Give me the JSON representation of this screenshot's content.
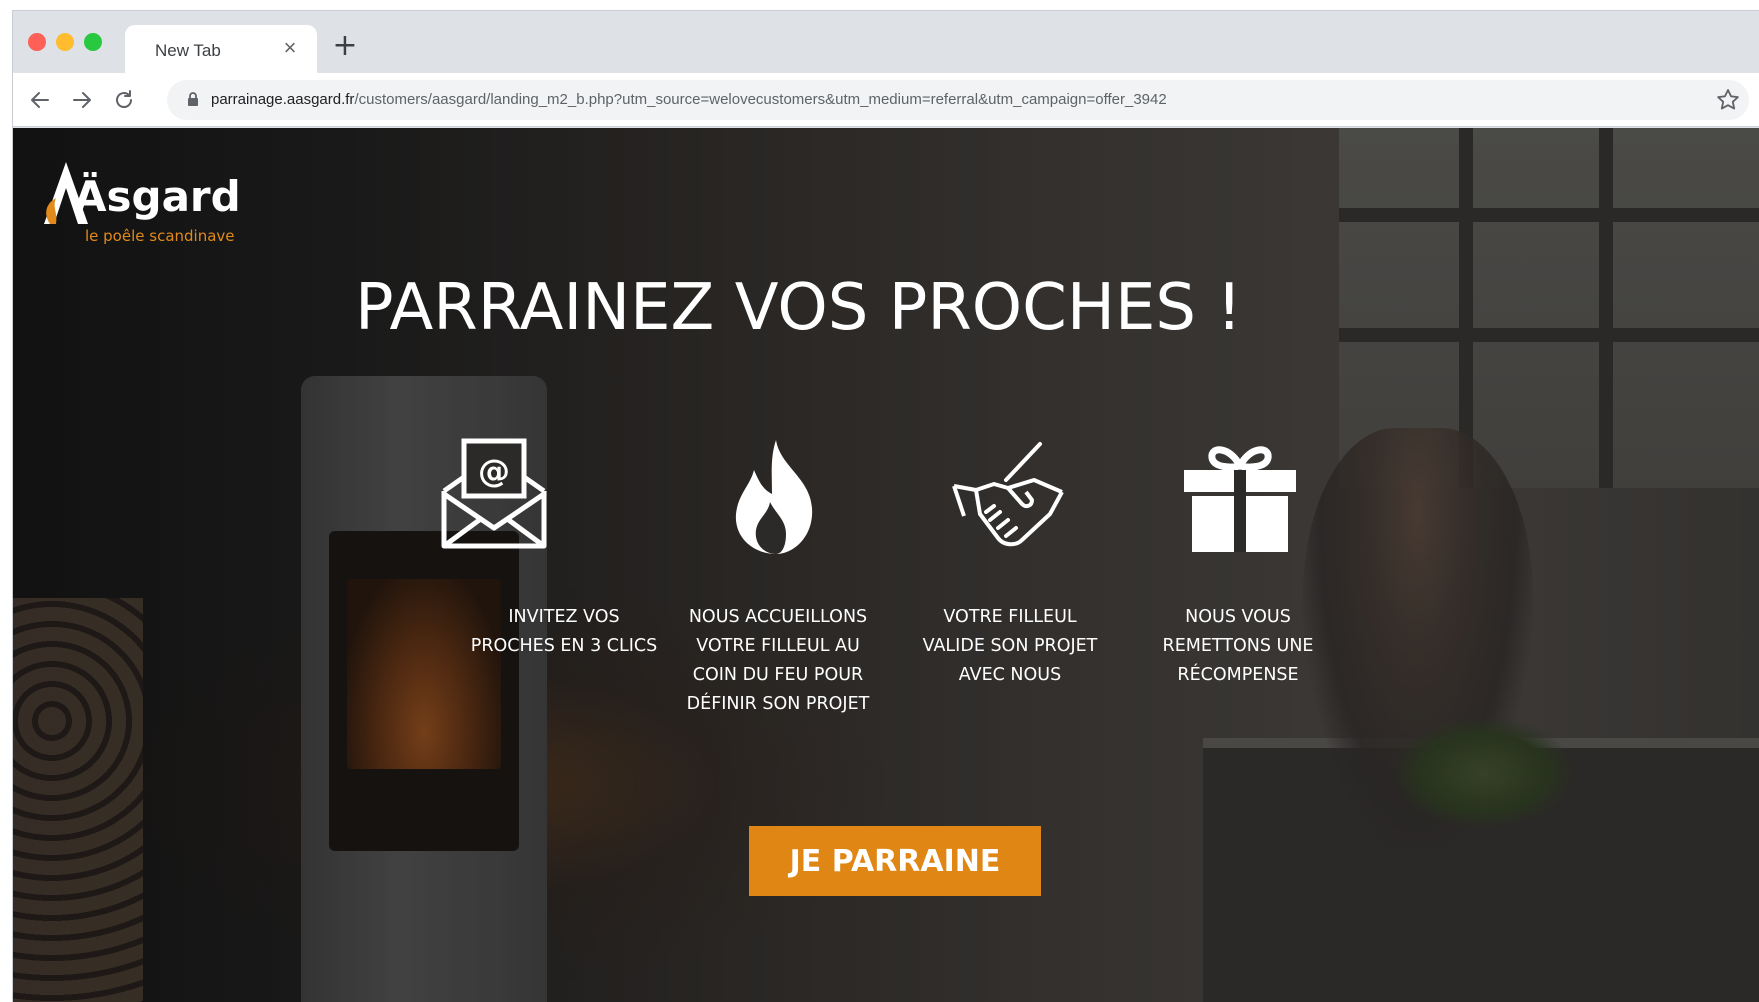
{
  "browser": {
    "tab_title": "New Tab",
    "tab_close": "×",
    "new_tab": "+",
    "url_host": "parrainage.aasgard.fr",
    "url_path": "/customers/aasgard/landing_m2_b.php?utm_source=welovecustomers&utm_medium=referral&utm_campaign=offer_3942"
  },
  "logo": {
    "wordmark": "Äsgard",
    "tagline": "le poêle scandinave"
  },
  "hero": {
    "headline": "PARRAINEZ VOS PROCHES !"
  },
  "steps": [
    {
      "icon": "envelope-at-icon",
      "text": "INVITEZ VOS PROCHES EN 3 CLICS"
    },
    {
      "icon": "flame-icon",
      "text": "NOUS ACCUEILLONS VOTRE FILLEUL AU COIN DU FEU POUR DÉFINIR SON PROJET"
    },
    {
      "icon": "handshake-icon",
      "text": "VOTRE FILLEUL VALIDE SON PROJET AVEC NOUS"
    },
    {
      "icon": "gift-icon",
      "text": "NOUS VOUS REMETTONS UNE RÉCOMPENSE"
    }
  ],
  "cta": {
    "label": "JE PARRAINE"
  },
  "colors": {
    "accent": "#e08614",
    "text": "#ffffff"
  }
}
